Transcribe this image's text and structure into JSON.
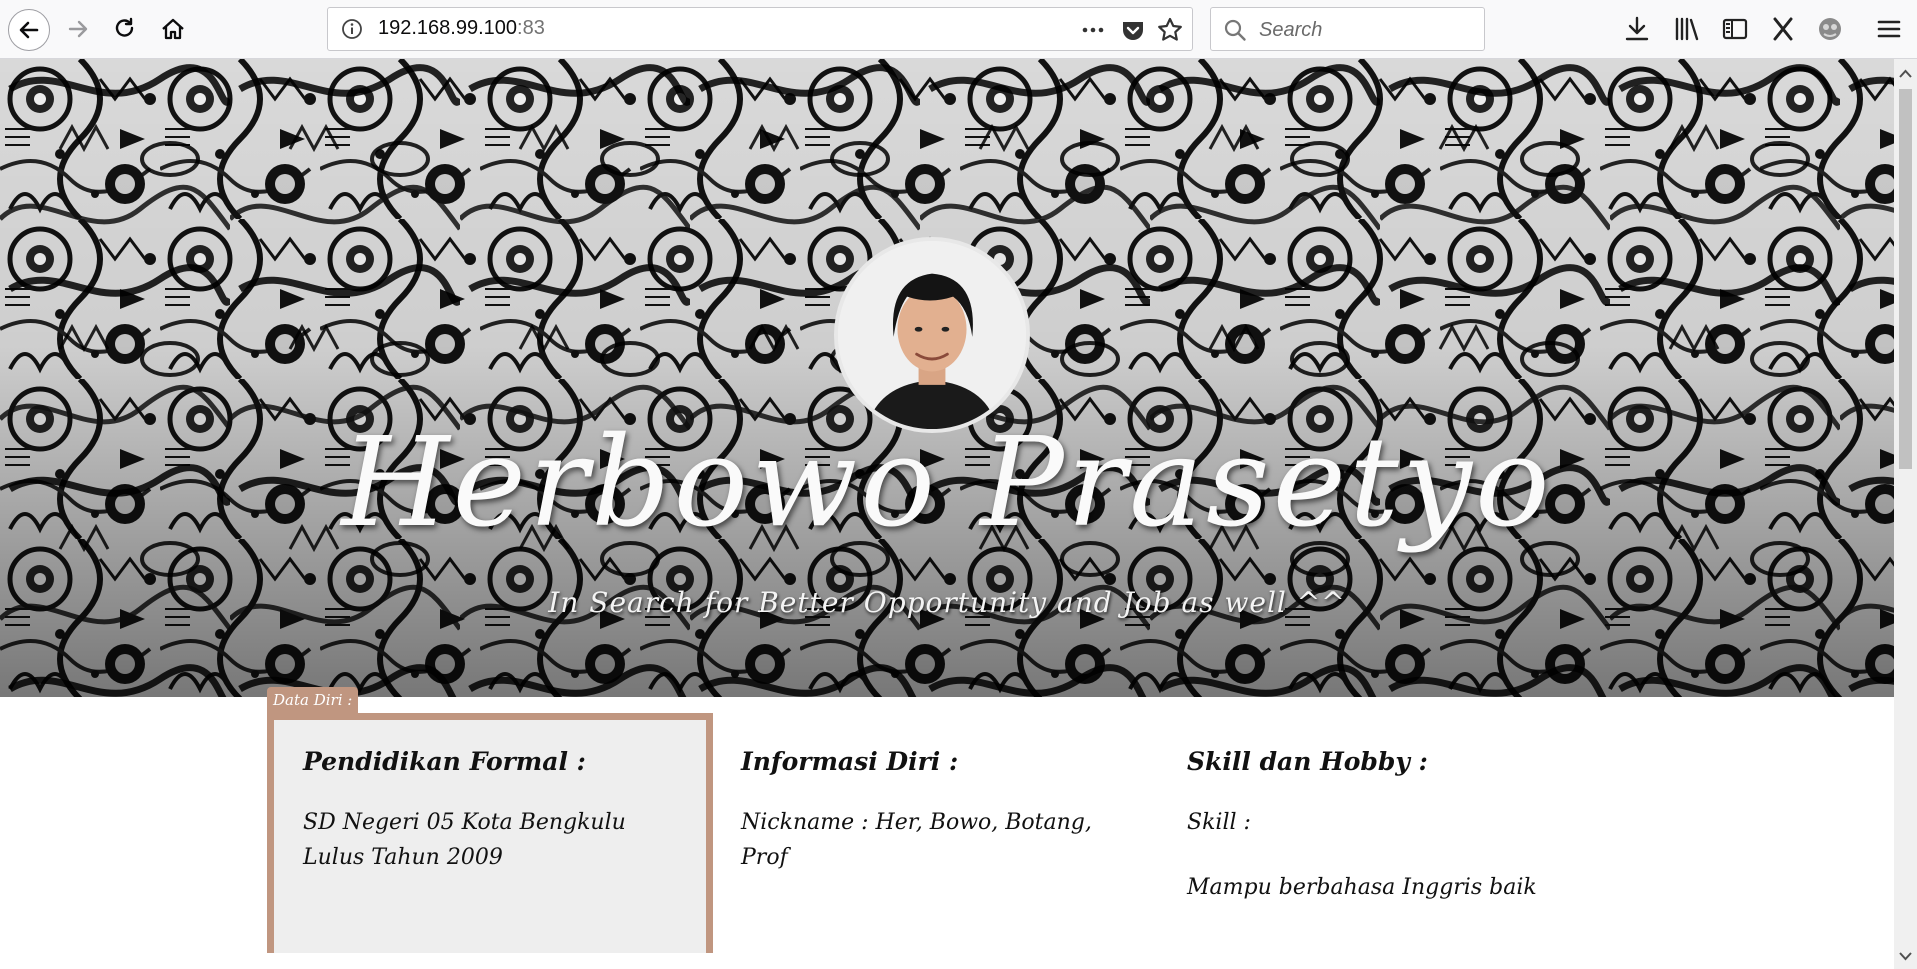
{
  "browser": {
    "url_host": "192.168.99.100",
    "url_port": ":83",
    "search_placeholder": "Search"
  },
  "hero": {
    "name": "Herbowo Prasetyo",
    "tagline": "In Search for Better Opportunity and Job as well ^^"
  },
  "section_tab": "Data Diri :",
  "columns": {
    "pendidikan": {
      "title": "Pendidikan Formal :",
      "line1": "SD Negeri 05 Kota Bengkulu",
      "line2": "Lulus Tahun 2009"
    },
    "informasi": {
      "title": "Informasi Diri :",
      "line1": "Nickname : Her, Bowo, Botang,",
      "line2": "Prof"
    },
    "skill": {
      "title": "Skill dan Hobby :",
      "line1": "Skill :",
      "line2": "Mampu berbahasa Inggris baik"
    }
  },
  "colors": {
    "accent": "#c09680",
    "card_background": "#eeeeee"
  }
}
